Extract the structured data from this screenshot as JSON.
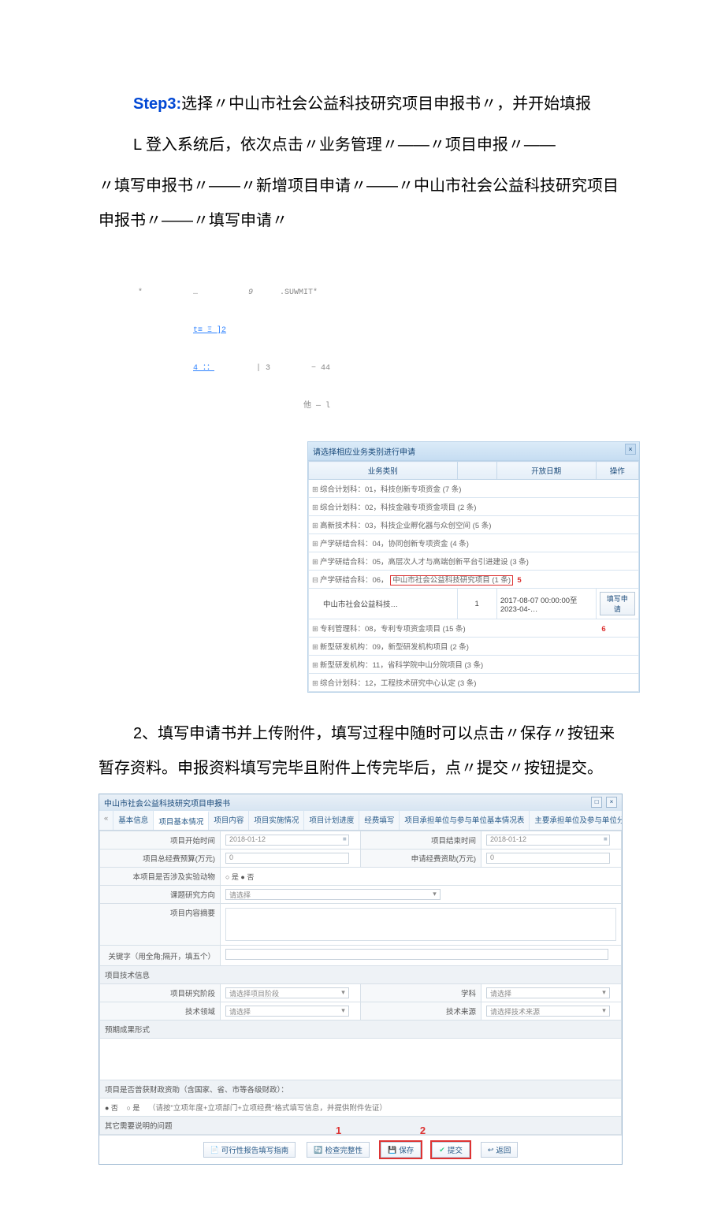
{
  "step": {
    "label": "Step3:",
    "title": "选择〃中山市社会公益科技研究项目申报书〃，并开始填报",
    "p1": "L 登入系统后，依次点击〃业务管理〃——〃项目申报〃——",
    "p2": "〃填写申报书〃——〃新增项目申请〃——〃中山市社会公益科技研究项目申报书〃——〃填写申请〃"
  },
  "fig1": {
    "artifacts": {
      "r1a": "*",
      "r1b": "…",
      "r1c": "9",
      "r1d": ".SUWMIT*",
      "r2": "t≡ Ξ ]2",
      "r3a": "4 ：：",
      "r3b": "| 3",
      "r3c": "− 44",
      "r4": "他 — l"
    },
    "panel_title": "请选择相应业务类别进行申请",
    "head_name": "业务类别",
    "head_date": "开放日期",
    "head_op": "操作",
    "mark5": "5",
    "mark6": "6",
    "btn_fill": "填写申请",
    "rows": [
      "综合计划科：01，科技创新专项资金 (7 条)",
      "综合计划科：02，科技金融专项资金项目 (2 条)",
      "高新技术科：03，科技企业孵化器与众创空间 (5 条)",
      "产学研结合科：04，协同创新专项资金 (4 条)",
      "产学研结合科：05，高层次人才与高端创新平台引进建设 (3 条)"
    ],
    "row_boxed_prefix": "产学研结合科：06，",
    "row_boxed_text": "中山市社会公益科技研究项目 (1 条)",
    "detail_name": "中山市社会公益科技…",
    "detail_count": "1",
    "detail_date": "2017-08-07 00:00:00至2023-04-…",
    "rows_after": [
      "专利管理科：08，专利专项资金项目 (15 条)",
      "新型研发机构：09，新型研发机构项目 (2 条)",
      "新型研发机构：11，省科学院中山分院项目 (3 条)",
      "综合计划科：12，工程技术研究中心认定 (3 条)"
    ]
  },
  "para2": "2、填写申请书并上传附件，填写过程中随时可以点击〃保存〃按钮来暂存资料。申报资料填写完毕且附件上传完毕后，点〃提交〃按钮提交。",
  "fig2": {
    "title": "中山市社会公益科技研究项目申报书",
    "tabs": [
      "基本信息",
      "项目基本情况",
      "项目内容",
      "项目实施情况",
      "项目计划进度",
      "经费填写",
      "项目承担单位与参与单位基本情况表",
      "主要承担单位及参与单位分工及经费分配计"
    ],
    "fields": {
      "start_label": "项目开始时间",
      "start_val": "2018-01-12",
      "end_label": "项目结束时间",
      "end_val": "2018-01-12",
      "total_label": "项目总经费预算(万元)",
      "total_val": "0",
      "apply_label": "申请经费资助(万元)",
      "apply_val": "0",
      "lab_label": "本项目是否涉及实验动物",
      "radio_no": "否",
      "radio_yes": "○ 是  ● 否",
      "dir_label": "课题研究方向",
      "dir_ph": "请选择",
      "sum_label": "项目内容摘要",
      "kw_label": "关键字（用全角;隔开，填五个）",
      "sect_tech": "项目技术信息",
      "stage_label": "项目研究阶段",
      "stage_ph": "请选择项目阶段",
      "subj_label": "学科",
      "subj_ph": "请选择",
      "field_label": "技术领域",
      "field_ph": "请选择",
      "src_label": "技术来源",
      "src_ph": "请选择技术来源",
      "out_label": "预期成果形式",
      "gov_label": "项目是否曾获财政资助（含国家、省、市等各级财政）：",
      "gov_hint": "（请按\"立项年度+立项部门+立项经费\"格式填写信息，并提供附件佐证）",
      "gov_no": "● 否",
      "gov_yes": "○ 是",
      "other_label": "其它需要说明的问题"
    },
    "nums": "1      2",
    "buttons": {
      "guide": "可行性报告填写指南",
      "perfect": "检查完整性",
      "save": "保存",
      "submit": "提交",
      "back": "返回"
    }
  }
}
